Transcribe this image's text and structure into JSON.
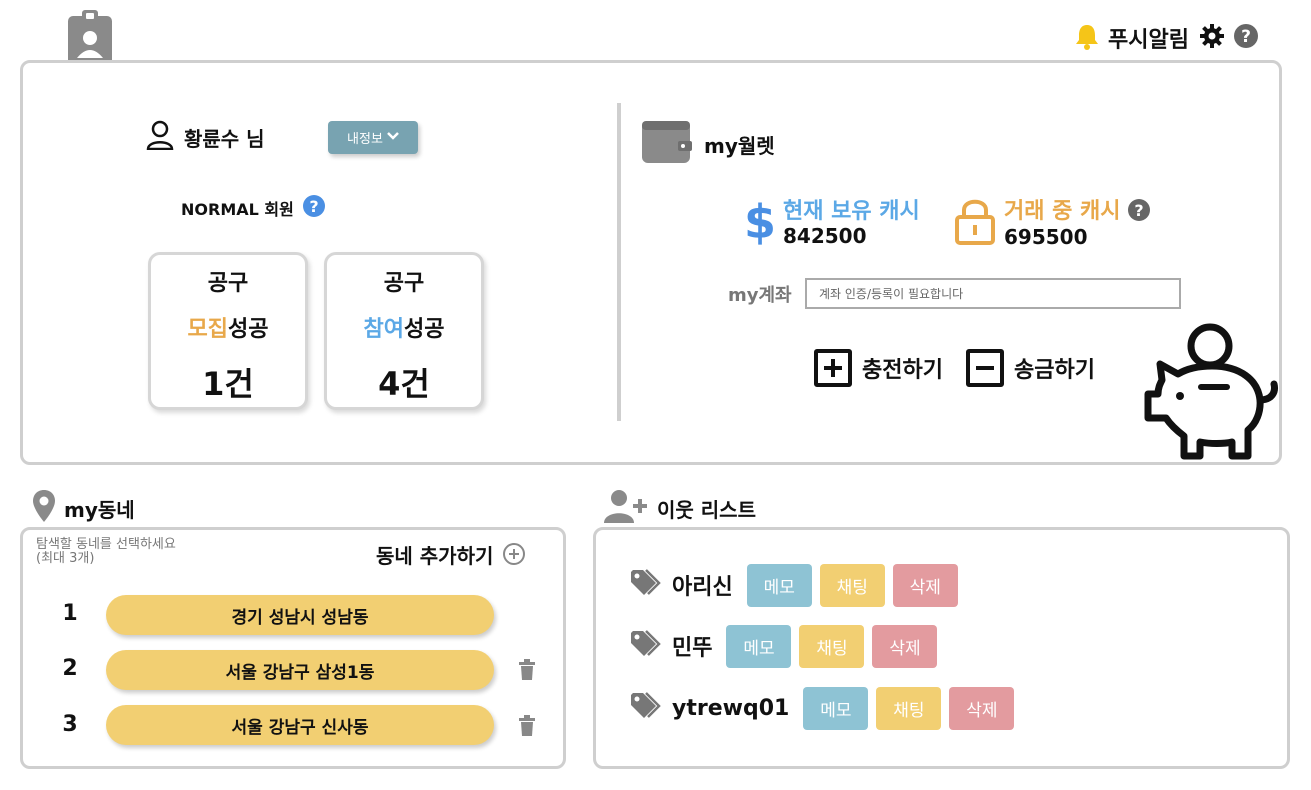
{
  "topbar": {
    "push_label": "푸시알림",
    "icons": [
      "profile-badge-icon",
      "bell-icon",
      "gear-icon",
      "help-icon"
    ]
  },
  "profile": {
    "user_name": "황륜수 님",
    "myinfo_label": "내정보",
    "membership": "NORMAL 회원"
  },
  "stats": [
    {
      "line1": "공구",
      "accent": "모집",
      "rest": "성공",
      "count": "1건",
      "accent_color": "#e8a84a"
    },
    {
      "line1": "공구",
      "accent": "참여",
      "rest": "성공",
      "count": "4건",
      "accent_color": "#5ba8e6"
    }
  ],
  "wallet": {
    "title": "my월렛",
    "current_cash_label": "현재 보유 캐시",
    "current_cash_value": "842500",
    "trading_cash_label": "거래 중 캐시",
    "trading_cash_value": "695500",
    "account_label": "my계좌",
    "account_placeholder": "계좌 인증/등록이 필요합니다",
    "charge_label": "충전하기",
    "send_label": "송금하기"
  },
  "dong": {
    "title": "my동네",
    "hint_line1": "탐색할 동네를 선택하세요",
    "hint_line2": "(최대 3개)",
    "add_label": "동네 추가하기",
    "items": [
      {
        "num": "1",
        "name": "경기 성남시 성남동"
      },
      {
        "num": "2",
        "name": "서울 강남구 삼성1동"
      },
      {
        "num": "3",
        "name": "서울 강남구 신사동"
      }
    ]
  },
  "neighbors": {
    "title": "이웃 리스트",
    "memo_label": "메모",
    "chat_label": "채팅",
    "delete_label": "삭제",
    "items": [
      {
        "name": "아리신"
      },
      {
        "name": "민뚜"
      },
      {
        "name": "ytrewq01"
      }
    ]
  },
  "colors": {
    "accent_orange": "#e8a84a",
    "accent_blue": "#5ba8e6",
    "myinfo_button": "#78a3b1",
    "dong_pill": "#f2cf72",
    "memo_chip": "#8ec3d4",
    "chat_chip": "#f2cf72",
    "delete_chip": "#e39b9f"
  }
}
